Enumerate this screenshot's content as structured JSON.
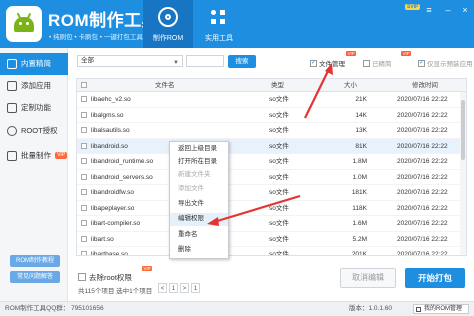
{
  "header": {
    "app_title": "ROM制作工具",
    "subtitle": "• 纯刷包 • 卡刷包 • 一键打包工具",
    "vip_badge": "SVIP",
    "tabs": [
      {
        "label": "制作ROM",
        "active": true
      },
      {
        "label": "实用工具",
        "active": false
      }
    ],
    "brand_color": "#1e8fe0"
  },
  "sidebar": {
    "items": [
      {
        "label": "内置精简",
        "active": true,
        "vip": false
      },
      {
        "label": "添加应用",
        "active": false,
        "vip": false
      },
      {
        "label": "定制功能",
        "active": false,
        "vip": false
      },
      {
        "label": "ROOT授权",
        "active": false,
        "vip": false
      },
      {
        "label": "批量制作",
        "active": false,
        "vip": true
      }
    ],
    "vip_label": "VIP",
    "bottom_buttons": [
      "ROM制作教程",
      "常见问题解答"
    ]
  },
  "filters": {
    "select_value": "全部",
    "search_value": "",
    "search_button": "搜索",
    "checks": [
      {
        "label": "文件管理",
        "checked": true,
        "dim": false
      },
      {
        "label": "已精简",
        "checked": false,
        "dim": true
      },
      {
        "label": "仅显示预装应用",
        "checked": true,
        "dim": true
      }
    ],
    "tag": "VIP"
  },
  "table": {
    "columns": [
      "文件名",
      "类型",
      "大小",
      "修改时间"
    ],
    "rows": [
      {
        "name": "libaehc_v2.so",
        "type": "so文件",
        "size": "21K",
        "time": "2020/07/16 22:22"
      },
      {
        "name": "libalgms.so",
        "type": "so文件",
        "size": "14K",
        "time": "2020/07/16 22:22"
      },
      {
        "name": "libalsautils.so",
        "type": "so文件",
        "size": "13K",
        "time": "2020/07/16 22:22"
      },
      {
        "name": "libandroid.so",
        "type": "so文件",
        "size": "81K",
        "time": "2020/07/16 22:22"
      },
      {
        "name": "libandroid_runtime.so",
        "type": "so文件",
        "size": "1.8M",
        "time": "2020/07/16 22:22"
      },
      {
        "name": "libandroid_servers.so",
        "type": "so文件",
        "size": "1.0M",
        "time": "2020/07/16 22:22"
      },
      {
        "name": "libandroidfw.so",
        "type": "so文件",
        "size": "181K",
        "time": "2020/07/16 22:22"
      },
      {
        "name": "libapeplayer.so",
        "type": "so文件",
        "size": "118K",
        "time": "2020/07/16 22:22"
      },
      {
        "name": "libart-compiler.so",
        "type": "so文件",
        "size": "1.6M",
        "time": "2020/07/16 22:22"
      },
      {
        "name": "libart.so",
        "type": "so文件",
        "size": "5.2M",
        "time": "2020/07/16 22:22"
      },
      {
        "name": "libartbase.so",
        "type": "so文件",
        "size": "201K",
        "time": "2020/07/16 22:22"
      }
    ]
  },
  "context_menu": {
    "items": [
      {
        "label": "返回上级目录",
        "disabled": false
      },
      {
        "label": "打开所在目录",
        "disabled": false
      },
      {
        "label": "新建文件夹",
        "disabled": true
      },
      {
        "label": "添加文件",
        "disabled": true
      },
      {
        "label": "导出文件",
        "disabled": false
      },
      {
        "label": "编辑权限",
        "disabled": false
      },
      {
        "label": "重命名",
        "disabled": false
      },
      {
        "label": "删除",
        "disabled": false
      }
    ]
  },
  "footer": {
    "root_check": "去除root权限",
    "root_tag": "VIP",
    "count_text": "共115个项目 选中1个项目",
    "pager": {
      "prev": "<",
      "current": "1",
      "next": ">",
      "page_total": "1"
    },
    "cancel_button": "取消编辑",
    "pack_button": "开始打包"
  },
  "statusbar": {
    "left": "ROM制作工具QQ群：  795101656",
    "version": "版本：1.0.1.60",
    "my_rom": "我的ROM管理"
  }
}
